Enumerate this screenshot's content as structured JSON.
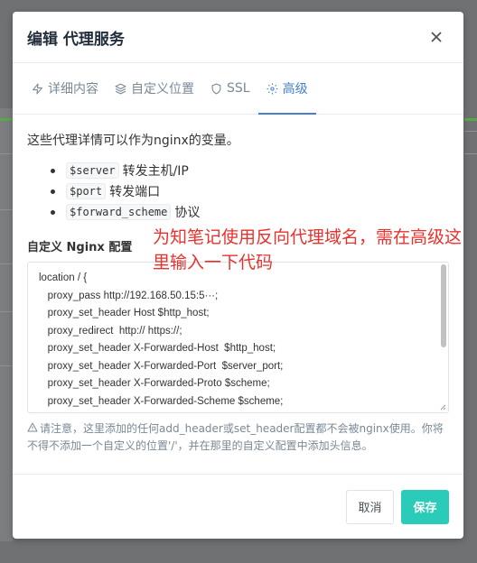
{
  "modal": {
    "title": "编辑 代理服务"
  },
  "tabs": [
    {
      "label": "详细内容",
      "icon": "bolt-icon"
    },
    {
      "label": "自定义位置",
      "icon": "layers-icon"
    },
    {
      "label": "SSL",
      "icon": "shield-icon"
    },
    {
      "label": "高级",
      "icon": "gear-icon"
    }
  ],
  "active_tab": "高级",
  "content": {
    "intro": "这些代理详情可以作为nginx的变量。",
    "variables": [
      {
        "name": "$server",
        "desc": "转发主机/IP"
      },
      {
        "name": "$port",
        "desc": "转发端口"
      },
      {
        "name": "$forward_scheme",
        "desc": "协议"
      }
    ],
    "config_label": "自定义 Nginx 配置",
    "config_lines": [
      "location / {",
      "   proxy_pass http://192.168.50.15:5···;",
      "   proxy_set_header Host $http_host;",
      "   proxy_redirect  http:// https://;",
      "   proxy_set_header X-Forwarded-Host  $http_host;",
      "   proxy_set_header X-Forwarded-Port  $server_port;",
      "   proxy_set_header X-Forwarded-Proto $scheme;",
      "   proxy_set_header X-Forwarded-Scheme $scheme;"
    ],
    "hint": "请注意，这里添加的任何add_header或set_header配置都不会被nginx使用。你将不得不添加一个自定义的位置'/'，并在那里的自定义配置中添加头信息。"
  },
  "annotation": "为知笔记使用反向代理域名，需在高级这里输入一下代码",
  "footer": {
    "cancel_label": "取消",
    "save_label": "保存"
  },
  "colors": {
    "accent": "#467fcf",
    "save": "#2bcbba",
    "annotation": "#e8322d"
  }
}
